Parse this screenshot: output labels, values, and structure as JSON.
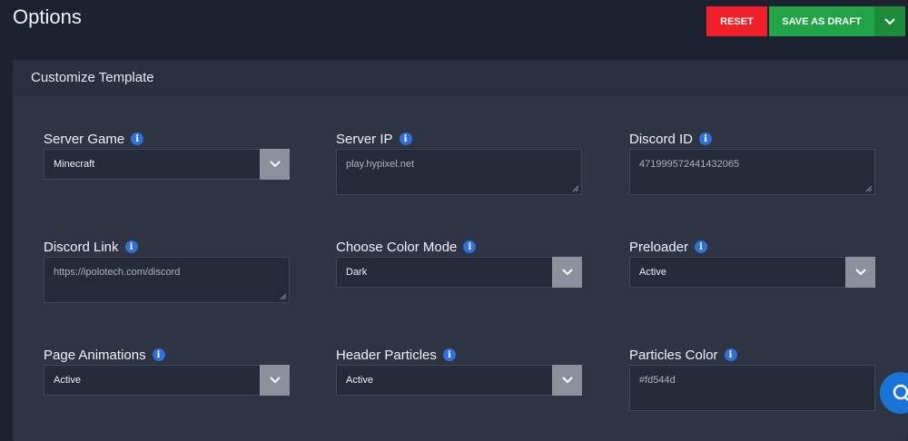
{
  "header": {
    "title": "Options",
    "reset_label": "RESET",
    "save_draft_label": "SAVE AS DRAFT"
  },
  "card": {
    "title": "Customize Template"
  },
  "fields": {
    "server_game": {
      "label": "Server Game",
      "value": "Minecraft"
    },
    "server_ip": {
      "label": "Server IP",
      "value": "play.hypixel.net"
    },
    "discord_id": {
      "label": "Discord ID",
      "value": "471999572441432065"
    },
    "discord_link": {
      "label": "Discord Link",
      "value": "https://ipolotech.com/discord"
    },
    "color_mode": {
      "label": "Choose Color Mode",
      "value": "Dark"
    },
    "preloader": {
      "label": "Preloader",
      "value": "Active"
    },
    "page_animations": {
      "label": "Page Animations",
      "value": "Active"
    },
    "header_particles": {
      "label": "Header Particles",
      "value": "Active"
    },
    "particles_color": {
      "label": "Particles Color",
      "value": "#fd544d"
    }
  },
  "colors": {
    "reset": "#f0202a",
    "save_draft": "#23a347",
    "info": "#2f6fd6",
    "chat": "#1a73d6"
  },
  "icons": {
    "info": "info-icon",
    "caret": "chevron-down-icon",
    "chat": "chat-icon"
  }
}
